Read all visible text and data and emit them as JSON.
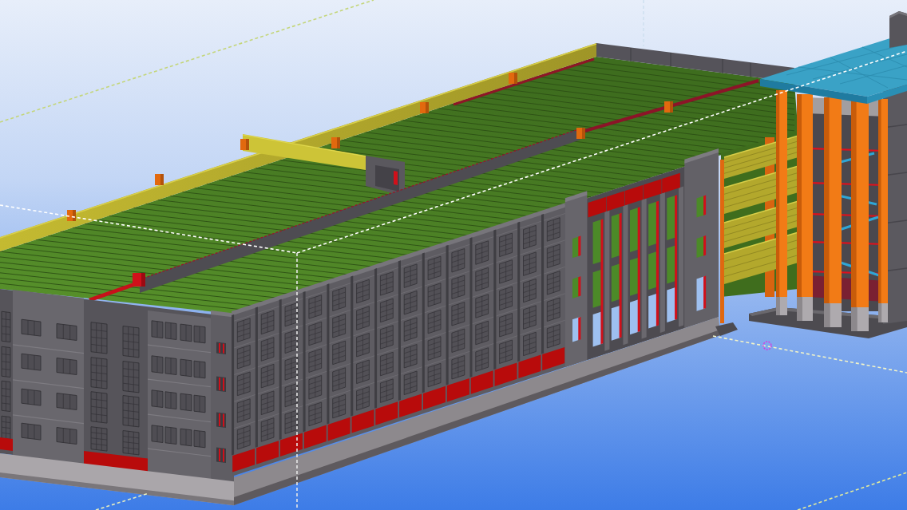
{
  "scene": {
    "objects": [
      {
        "kind": "building"
      },
      {
        "kind": "tower"
      },
      {
        "kind": "guides"
      },
      {
        "kind": "marker"
      }
    ]
  }
}
